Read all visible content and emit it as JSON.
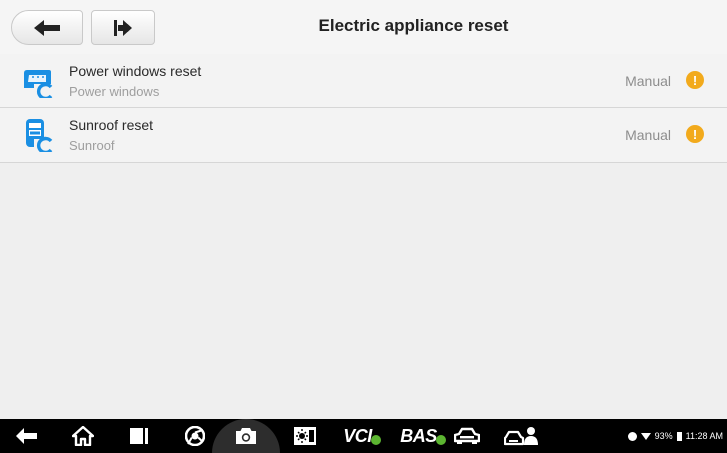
{
  "header": {
    "title": "Electric appliance reset"
  },
  "rows": [
    {
      "title": "Power windows reset",
      "subtitle": "Power windows",
      "status": "Manual",
      "icon": "power-window-icon"
    },
    {
      "title": "Sunroof reset",
      "subtitle": "Sunroof",
      "status": "Manual",
      "icon": "sunroof-icon"
    }
  ],
  "taskbar": {
    "vci_label": "VCI",
    "bas_label": "BAS",
    "battery": "93%",
    "time": "11:28 AM"
  },
  "colors": {
    "accent_blue": "#1a8fe3",
    "warning": "#f2aa1c",
    "bt_green": "#5cb531"
  }
}
